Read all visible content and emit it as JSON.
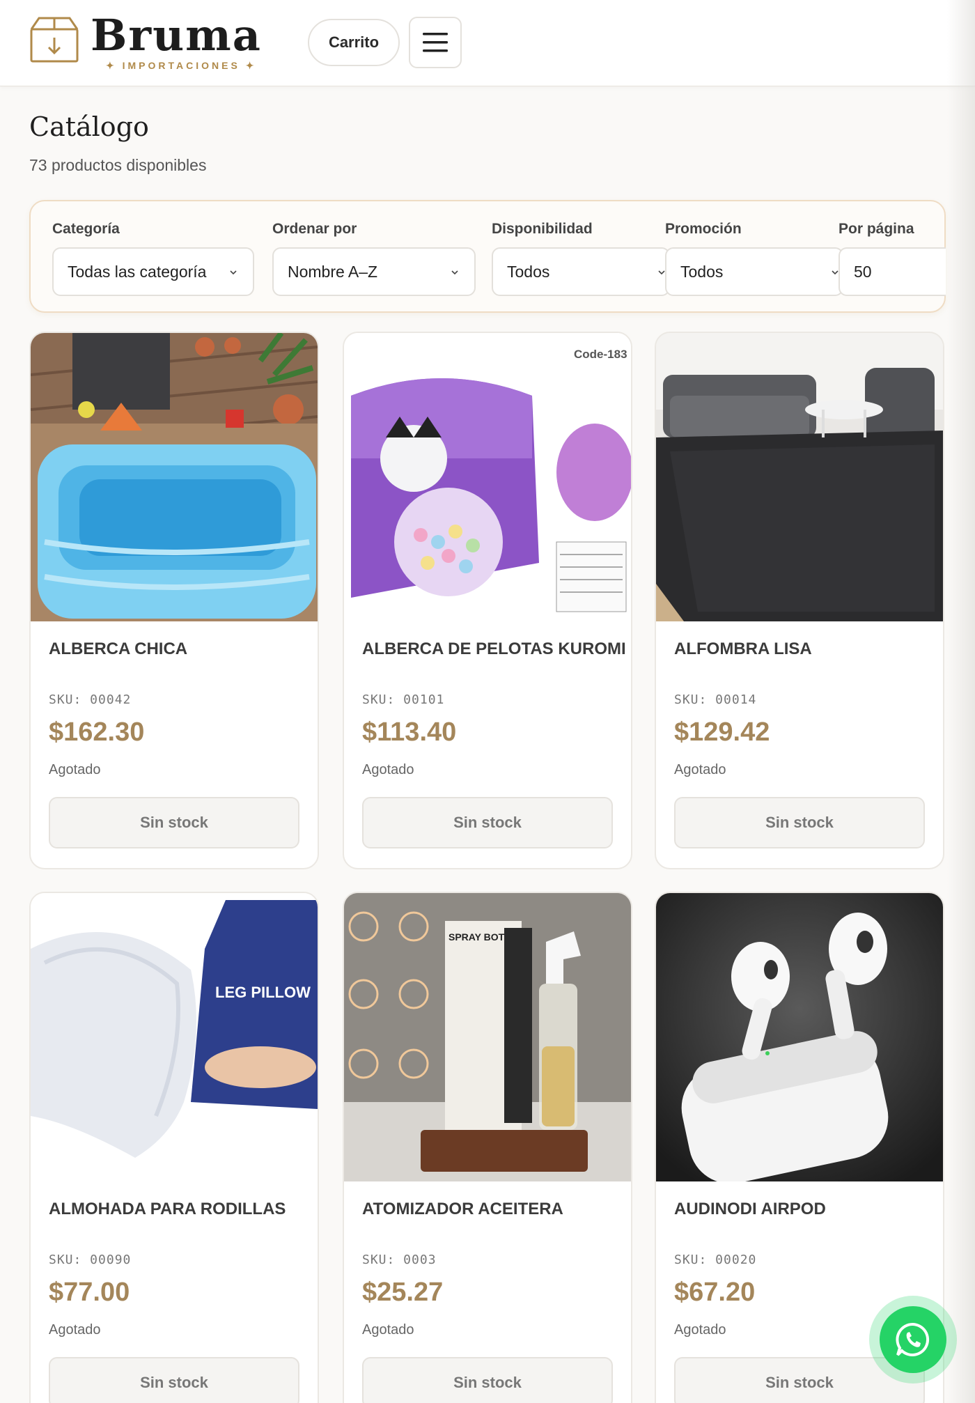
{
  "header": {
    "brand": "Bruma",
    "brand_sub": "✦ IMPORTACIONES ✦",
    "cart_label": "Carrito"
  },
  "page": {
    "title": "Catálogo",
    "subtitle": "73 productos disponibles"
  },
  "filters": {
    "category": {
      "label": "Categoría",
      "value": "Todas las categoría"
    },
    "sort": {
      "label": "Ordenar por",
      "value": "Nombre A–Z"
    },
    "availability": {
      "label": "Disponibilidad",
      "value": "Todos"
    },
    "promotion": {
      "label": "Promoción",
      "value": "Todos"
    },
    "per_page": {
      "label": "Por página",
      "value": "50"
    }
  },
  "products": [
    {
      "name": "ALBERCA CHICA",
      "sku": "SKU: 00042",
      "price": "$162.30",
      "status": "Agotado",
      "button": "Sin stock",
      "image": "inflatable-pool"
    },
    {
      "name": "ALBERCA DE PELOTAS KUROMI",
      "sku": "SKU: 00101",
      "price": "$113.40",
      "status": "Agotado",
      "button": "Sin stock",
      "image": "ball-pit-tent",
      "image_code": "Code-183"
    },
    {
      "name": "ALFOMBRA LISA",
      "sku": "SKU: 00014",
      "price": "$129.42",
      "status": "Agotado",
      "button": "Sin stock",
      "image": "living-room-rug"
    },
    {
      "name": "ALMOHADA PARA RODILLAS",
      "sku": "SKU: 00090",
      "price": "$77.00",
      "status": "Agotado",
      "button": "Sin stock",
      "image": "knee-pillow",
      "image_text": "LEG PILLOW"
    },
    {
      "name": "ATOMIZADOR ACEITERA",
      "sku": "SKU: 0003",
      "price": "$25.27",
      "status": "Agotado",
      "button": "Sin stock",
      "image": "oil-spray-bottle",
      "image_text": "SPRAY BOTTLE"
    },
    {
      "name": "AUDINODI AIRPOD",
      "sku": "SKU: 00020",
      "price": "$67.20",
      "status": "Agotado",
      "button": "Sin stock",
      "image": "earbuds"
    }
  ],
  "colors": {
    "accent": "#a4865a",
    "brand_gold": "#b08a4a",
    "whatsapp": "#25d366"
  }
}
